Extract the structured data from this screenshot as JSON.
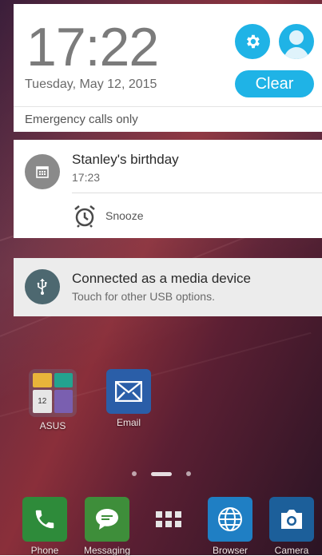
{
  "header": {
    "time": "17:22",
    "date": "Tuesday, May 12, 2015",
    "clear_label": "Clear"
  },
  "status": {
    "emergency": "Emergency calls only"
  },
  "notifications": [
    {
      "title": "Stanley's birthday",
      "subtitle": "17:23",
      "action": "Snooze",
      "icon": "calendar-icon"
    },
    {
      "title": "Connected as a media device",
      "subtitle": "Touch for other USB options.",
      "icon": "usb-icon"
    }
  ],
  "home": {
    "apps": [
      {
        "label": "ASUS",
        "icon": "folder-icon"
      },
      {
        "label": "Email",
        "icon": "email-icon"
      }
    ],
    "folder_badge": "12"
  },
  "dock": [
    {
      "label": "Phone",
      "icon": "phone-icon",
      "color": "#2e8b3a"
    },
    {
      "label": "Messaging",
      "icon": "messaging-icon",
      "color": "#3e8e3a"
    },
    {
      "label": "",
      "icon": "app-drawer-icon",
      "color": ""
    },
    {
      "label": "Browser",
      "icon": "globe-icon",
      "color": "#1f7fc4"
    },
    {
      "label": "Camera",
      "icon": "camera-icon",
      "color": "#1c5f9a"
    }
  ],
  "colors": {
    "accent": "#1fb3e6",
    "card": "#ffffff",
    "usb_card": "#ececec"
  }
}
